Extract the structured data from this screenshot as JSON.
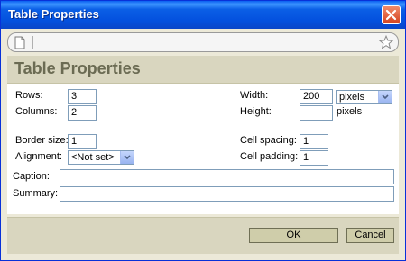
{
  "window": {
    "title": "Table Properties"
  },
  "header": {
    "title": "Table Properties"
  },
  "form": {
    "rows_label": "Rows:",
    "rows_value": "3",
    "columns_label": "Columns:",
    "columns_value": "2",
    "border_label": "Border size:",
    "border_value": "1",
    "alignment_label": "Alignment:",
    "alignment_value": "<Not set>",
    "width_label": "Width:",
    "width_value": "200",
    "width_unit": "pixels",
    "height_label": "Height:",
    "height_value": "",
    "height_unit": "pixels",
    "cell_spacing_label": "Cell spacing:",
    "cell_spacing_value": "1",
    "cell_padding_label": "Cell padding:",
    "cell_padding_value": "1",
    "caption_label": "Caption:",
    "caption_value": "",
    "summary_label": "Summary:",
    "summary_value": ""
  },
  "buttons": {
    "ok": "OK",
    "cancel": "Cancel"
  },
  "icons": {
    "close": "close-icon",
    "document": "document-icon",
    "star": "star-icon"
  },
  "colors": {
    "titlebar": "#0a55e0",
    "header_bg": "#d9d6bf",
    "header_text": "#6b6b53",
    "button_bg": "#cfcdaa"
  }
}
